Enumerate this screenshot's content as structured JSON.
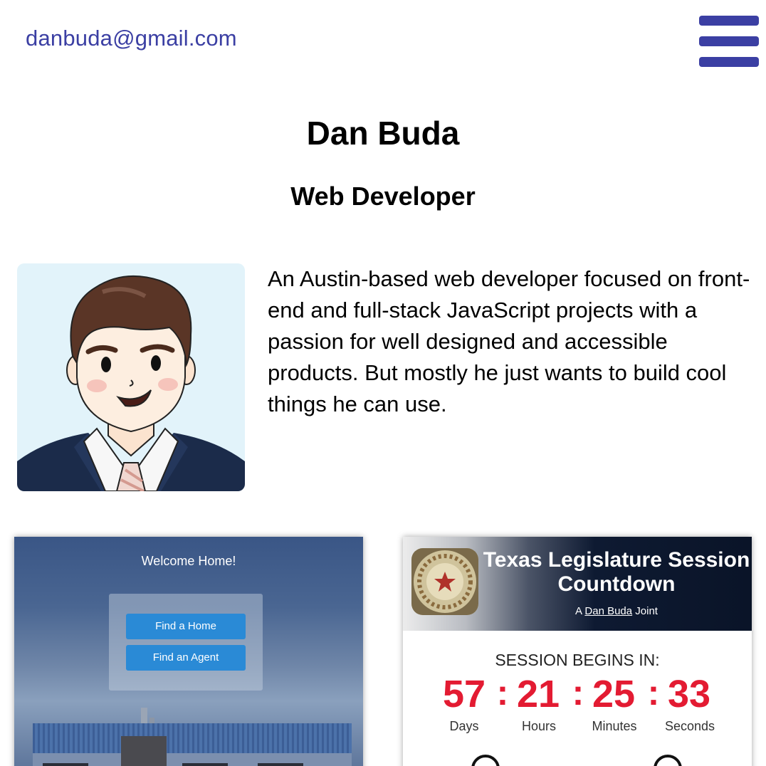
{
  "header": {
    "email": "danbuda@gmail.com",
    "menu_icon": "hamburger-menu-icon",
    "accent_color": "#3b3fa3"
  },
  "hero": {
    "name": "Dan Buda",
    "role": "Web Developer"
  },
  "about": {
    "avatar_icon": "avatar-illustration",
    "bio": "An Austin-based web developer focused on front-end and full-stack JavaScript projects with a passion for well designed and accessible products. But mostly he just wants to build cool things he can use."
  },
  "projects": [
    {
      "welcome": "Welcome Home!",
      "buttons": [
        "Find a Home",
        "Find an Agent"
      ]
    },
    {
      "title": "Texas Legislature Session Countdown",
      "joint_prefix": "A",
      "joint_link": "Dan Buda",
      "joint_suffix": "Joint",
      "session_label": "SESSION BEGINS IN:",
      "countdown": {
        "days": "57",
        "hours": "21",
        "minutes": "25",
        "seconds": "33"
      },
      "units": [
        "Days",
        "Hours",
        "Minutes",
        "Seconds"
      ],
      "countdown_color": "#e31b32"
    }
  ]
}
